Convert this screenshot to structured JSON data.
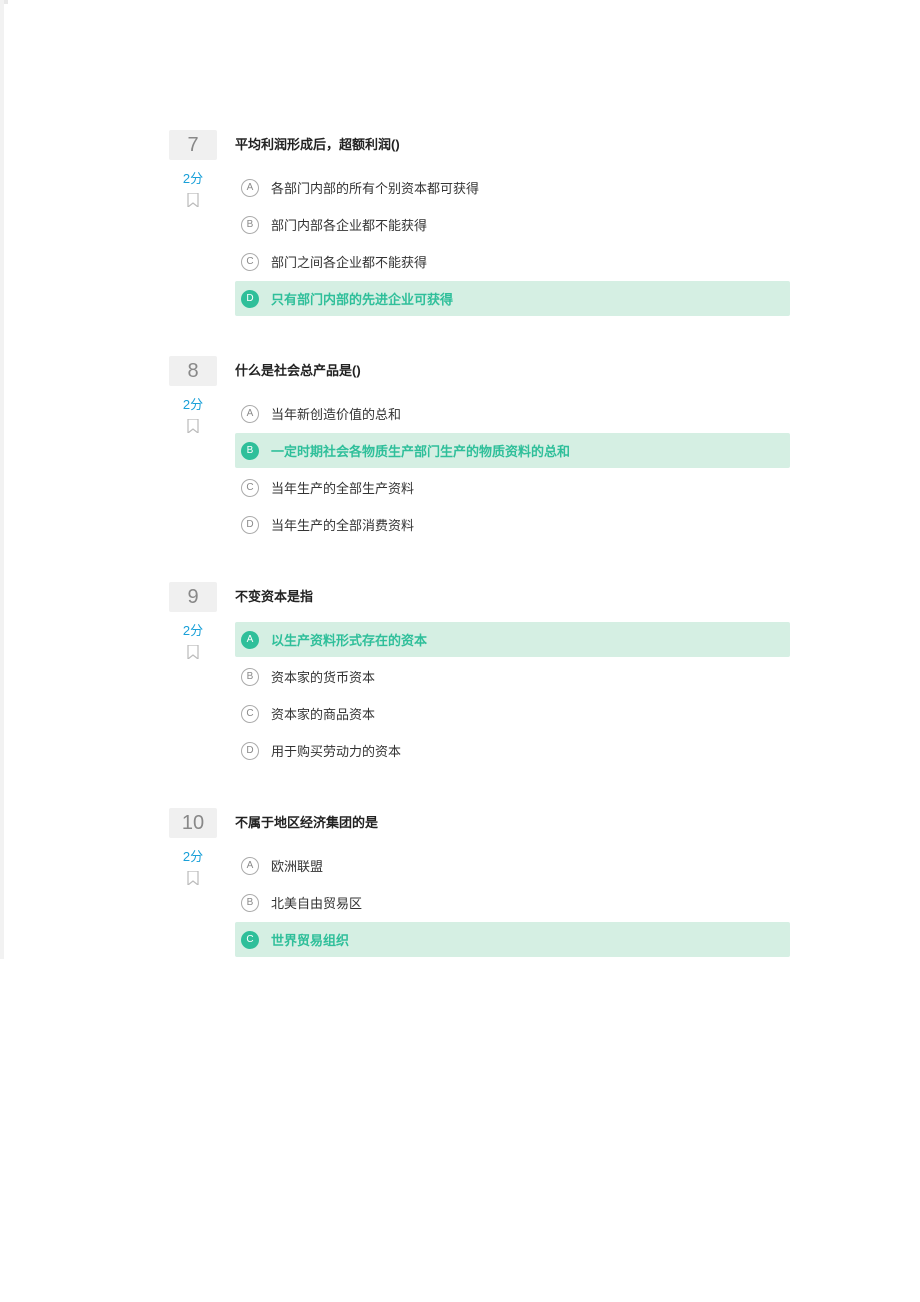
{
  "questions": [
    {
      "number": "7",
      "score": "2分",
      "text": "平均利润形成后，超额利润()",
      "options": [
        {
          "letter": "A",
          "text": "各部门内部的所有个别资本都可获得",
          "correct": false
        },
        {
          "letter": "B",
          "text": "部门内部各企业都不能获得",
          "correct": false
        },
        {
          "letter": "C",
          "text": "部门之间各企业都不能获得",
          "correct": false
        },
        {
          "letter": "D",
          "text": "只有部门内部的先进企业可获得",
          "correct": true
        }
      ]
    },
    {
      "number": "8",
      "score": "2分",
      "text": "什么是社会总产品是()",
      "options": [
        {
          "letter": "A",
          "text": "当年新创造价值的总和",
          "correct": false
        },
        {
          "letter": "B",
          "text": "一定时期社会各物质生产部门生产的物质资料的总和",
          "correct": true
        },
        {
          "letter": "C",
          "text": "当年生产的全部生产资料",
          "correct": false
        },
        {
          "letter": "D",
          "text": "当年生产的全部消费资料",
          "correct": false
        }
      ]
    },
    {
      "number": "9",
      "score": "2分",
      "text": "不变资本是指",
      "options": [
        {
          "letter": "A",
          "text": "以生产资料形式存在的资本",
          "correct": true
        },
        {
          "letter": "B",
          "text": "资本家的货币资本",
          "correct": false
        },
        {
          "letter": "C",
          "text": "资本家的商品资本",
          "correct": false
        },
        {
          "letter": "D",
          "text": "用于购买劳动力的资本",
          "correct": false
        }
      ]
    },
    {
      "number": "10",
      "score": "2分",
      "text": "不属于地区经济集团的是",
      "options": [
        {
          "letter": "A",
          "text": "欧洲联盟",
          "correct": false
        },
        {
          "letter": "B",
          "text": "北美自由贸易区",
          "correct": false
        },
        {
          "letter": "C",
          "text": "世界贸易组织",
          "correct": true
        }
      ]
    }
  ]
}
